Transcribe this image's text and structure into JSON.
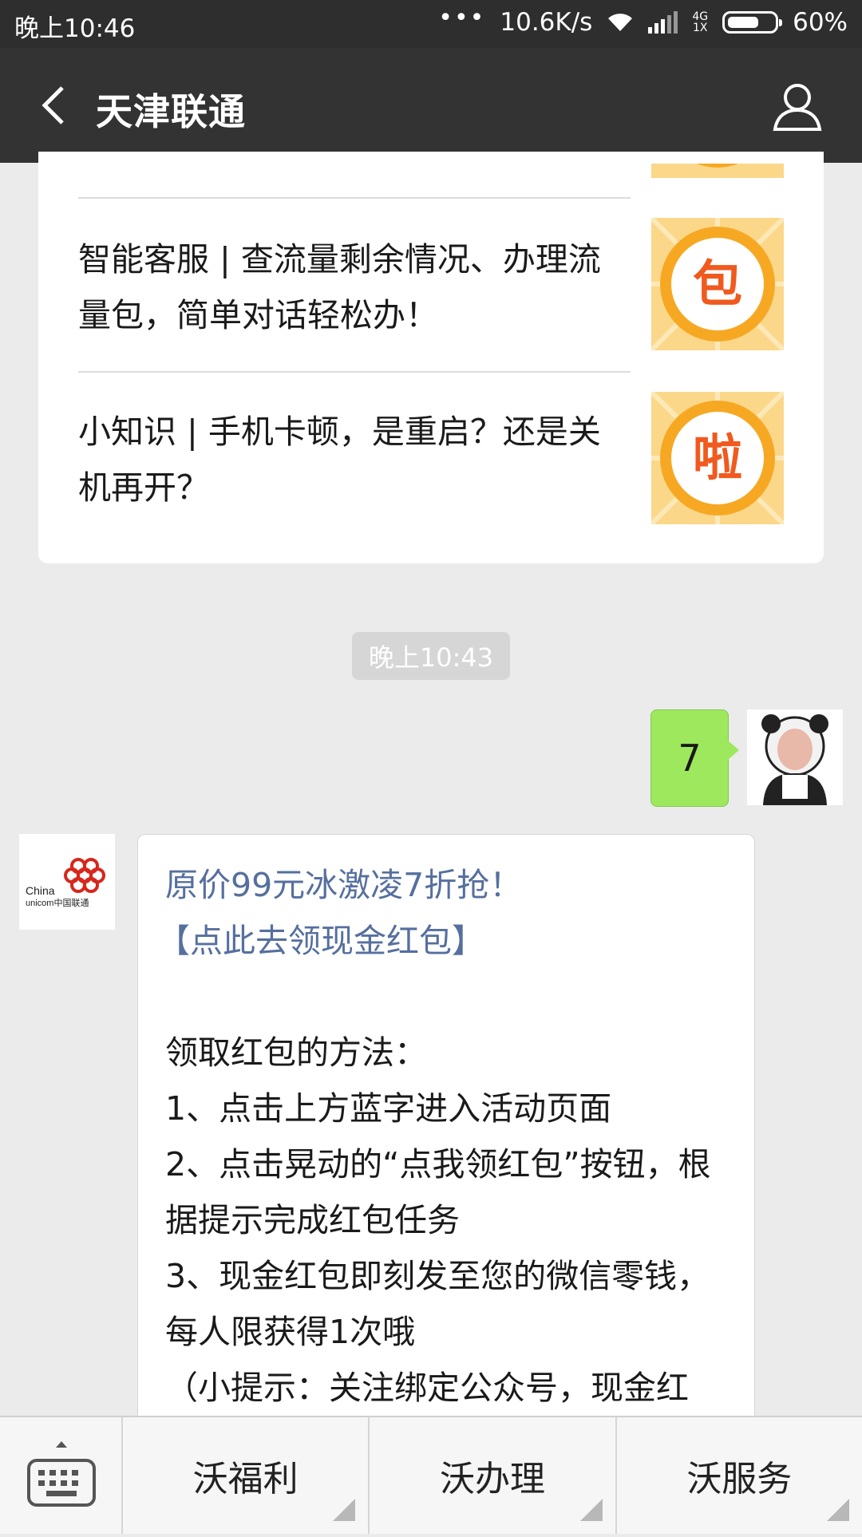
{
  "status_bar": {
    "time": "晚上10:46",
    "dots": "•••",
    "speed": "10.6K/s",
    "network": "4G",
    "network_sub": "1X",
    "battery": "60%",
    "battery_level": 0.6
  },
  "header": {
    "title": "天津联通"
  },
  "articles": [
    {
      "title": "智能客服 | 查流量剩余情况、办理流量包，简单对话轻松办！",
      "thumb_char": "包"
    },
    {
      "title": "小知识 | 手机卡顿，是重启？还是关机再开？",
      "thumb_char": "啦"
    }
  ],
  "timestamp": "晚上10:43",
  "my_message": {
    "text": "7"
  },
  "oa_message": {
    "logo_line1": "China",
    "logo_line2": "unicom中国联通",
    "link1": "原价99元冰激凌7折抢！",
    "link2": "【点此去领现金红包】",
    "heading": "领取红包的方法：",
    "step1": "1、点击上方蓝字进入活动页面",
    "step2": "2、点击晃动的“点我领红包”按钮，根据提示完成红包任务",
    "step3": "3、现金红包即刻发至您的微信零钱，每人限获得1次哦",
    "tip": "（小提示：关注绑定公众号，现金红"
  },
  "bottom_menu": {
    "items": [
      "沃福利",
      "沃办理",
      "沃服务"
    ]
  },
  "colors": {
    "header_bg": "#333333",
    "my_bubble": "#9ee85e",
    "link": "#566f9e",
    "badge_orange": "#f05a1e"
  }
}
